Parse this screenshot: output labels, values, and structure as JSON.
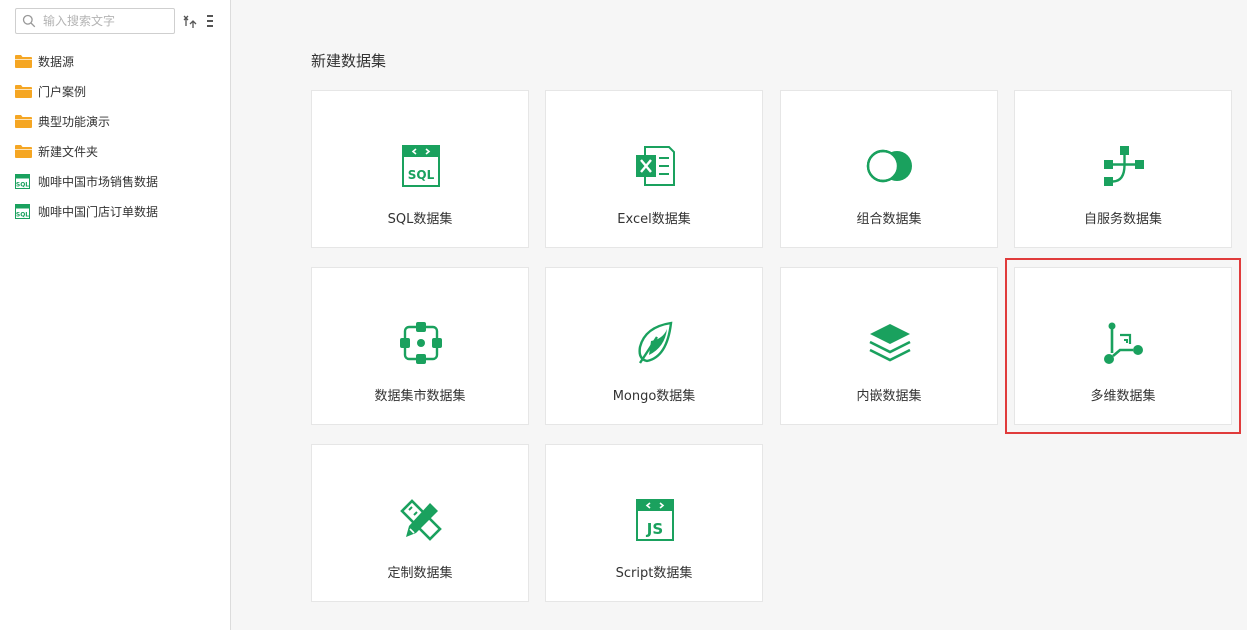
{
  "sidebar": {
    "search": {
      "placeholder": "输入搜索文字",
      "value": ""
    },
    "items": [
      {
        "label": "数据源",
        "type": "folder"
      },
      {
        "label": "门户案例",
        "type": "folder"
      },
      {
        "label": "典型功能演示",
        "type": "folder"
      },
      {
        "label": "新建文件夹",
        "type": "folder"
      },
      {
        "label": "咖啡中国市场销售数据",
        "type": "sql"
      },
      {
        "label": "咖啡中国门店订单数据",
        "type": "sql"
      }
    ]
  },
  "main": {
    "title": "新建数据集",
    "cards": [
      {
        "label": "SQL数据集",
        "icon": "sql-icon"
      },
      {
        "label": "Excel数据集",
        "icon": "excel-icon"
      },
      {
        "label": "组合数据集",
        "icon": "combine-icon"
      },
      {
        "label": "自服务数据集",
        "icon": "self-service-icon"
      },
      {
        "label": "数据集市数据集",
        "icon": "data-mart-icon"
      },
      {
        "label": "Mongo数据集",
        "icon": "mongo-leaf-icon"
      },
      {
        "label": "内嵌数据集",
        "icon": "layers-icon"
      },
      {
        "label": "多维数据集",
        "icon": "multidimensional-icon"
      },
      {
        "label": "定制数据集",
        "icon": "ruler-pencil-icon"
      },
      {
        "label": "Script数据集",
        "icon": "js-icon"
      }
    ]
  },
  "colors": {
    "accent": "#1aa15e",
    "folder": "#f5a623",
    "highlight": "#e03b3b"
  }
}
